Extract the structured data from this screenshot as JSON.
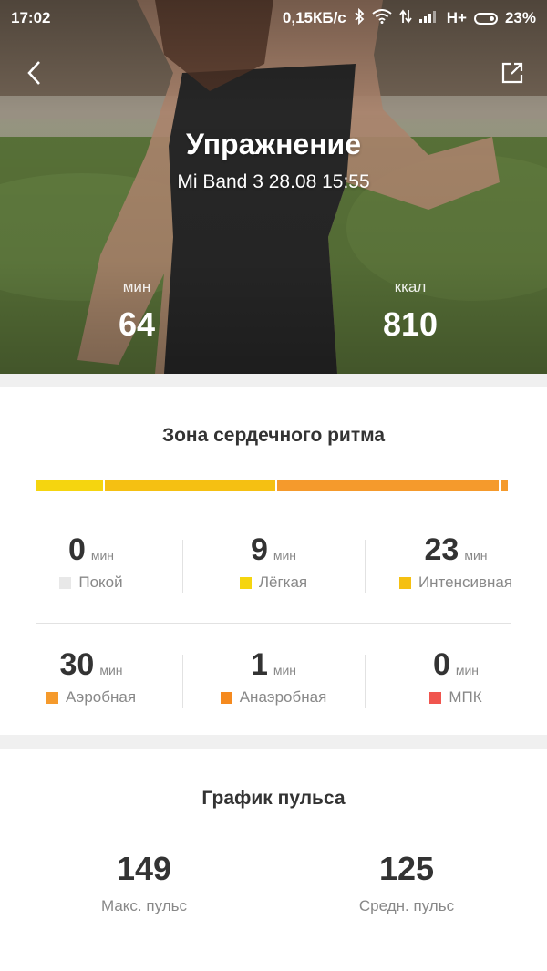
{
  "status_bar": {
    "time": "17:02",
    "speed": "0,15КБ/с",
    "network": "H+",
    "battery": "23%"
  },
  "header": {
    "title": "Упражнение",
    "subtitle": "Mi Band 3 28.08 15:55",
    "stats": [
      {
        "unit": "мин",
        "value": "64"
      },
      {
        "unit": "ккал",
        "value": "810"
      }
    ]
  },
  "heart_rate_zone": {
    "title": "Зона сердечного ритма",
    "bar_colors": [
      "#f5d50f",
      "#f5c012",
      "#f59a2c",
      "#f59a2c"
    ],
    "bar_weights": [
      9,
      23,
      30,
      1
    ],
    "zones": [
      {
        "value": "0",
        "unit": "мин",
        "label": "Покой",
        "color": "#e8e8e8"
      },
      {
        "value": "9",
        "unit": "мин",
        "label": "Лёгкая",
        "color": "#f5d50f"
      },
      {
        "value": "23",
        "unit": "мин",
        "label": "Интенсивная",
        "color": "#f5c012"
      },
      {
        "value": "30",
        "unit": "мин",
        "label": "Аэробная",
        "color": "#f59a2c"
      },
      {
        "value": "1",
        "unit": "мин",
        "label": "Анаэробная",
        "color": "#f58a1f"
      },
      {
        "value": "0",
        "unit": "мин",
        "label": "МПК",
        "color": "#f0554e"
      }
    ]
  },
  "pulse_chart": {
    "title": "График пульса",
    "stats": [
      {
        "value": "149",
        "label": "Макс. пульс"
      },
      {
        "value": "125",
        "label": "Средн. пульс"
      }
    ]
  }
}
